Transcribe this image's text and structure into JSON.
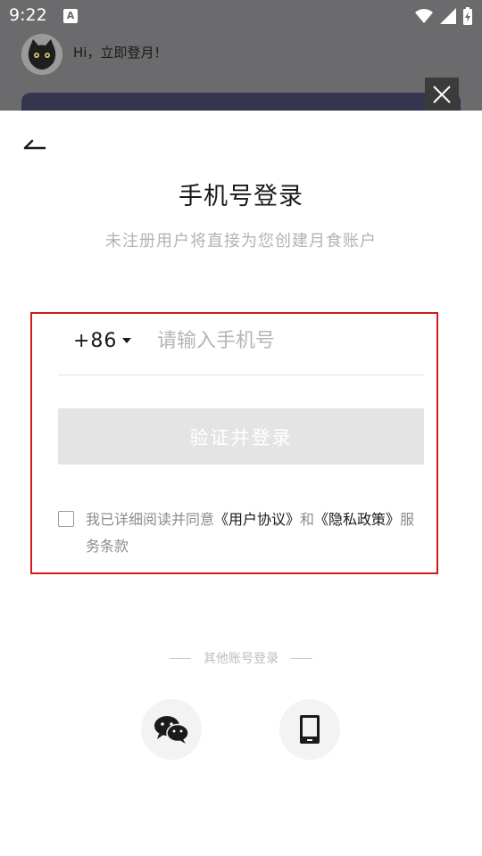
{
  "status_bar": {
    "time": "9:22",
    "notification_icon": "a-box-icon",
    "icons": [
      "wifi-icon",
      "signal-icon",
      "battery-charging-icon"
    ]
  },
  "background_app": {
    "greeting": "Hi，立即登月！",
    "avatar_icon": "cat-avatar-icon"
  },
  "sheet": {
    "title": "手机号登录",
    "subtitle": "未注册用户将直接为您创建月食账户",
    "phone": {
      "country_code": "+86",
      "placeholder": "请输入手机号",
      "value": ""
    },
    "login_button": "验证并登录",
    "agreement": {
      "checked": false,
      "prefix": "我已详细阅读并同意",
      "user_agreement": "《用户协议》",
      "and": "和",
      "privacy_policy": "《隐私政策》",
      "suffix": "服务条款"
    },
    "other_login_label": "其他账号登录",
    "social_buttons": [
      "wechat-icon",
      "mobile-phone-icon"
    ]
  },
  "colors": {
    "highlight_border": "#d11a1a",
    "disabled_button": "#e4e4e4",
    "placeholder": "#b5b5b5"
  }
}
